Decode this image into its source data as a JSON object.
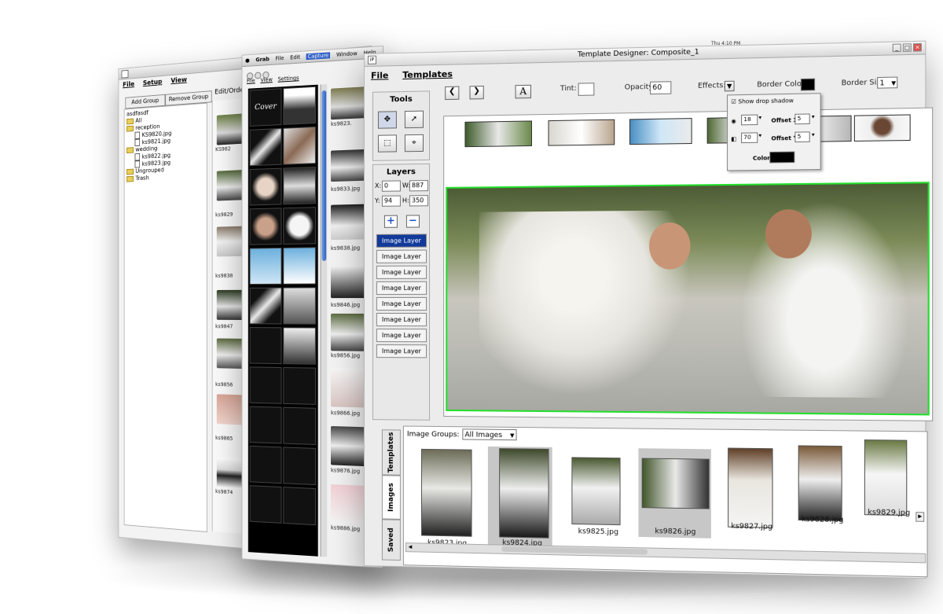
{
  "back_window": {
    "menu": [
      "File",
      "Setup",
      "View"
    ],
    "buttons": {
      "add_group": "Add Group",
      "remove_group": "Remove Group"
    },
    "tab_label": "Edit/Orde",
    "tree": [
      {
        "label": "asdfasdf",
        "type": "root"
      },
      {
        "label": "All",
        "type": "folder"
      },
      {
        "label": "reception",
        "type": "folder"
      },
      {
        "label": "KS9820.jpg",
        "type": "file"
      },
      {
        "label": "ks9821.jpg",
        "type": "file"
      },
      {
        "label": "wedding",
        "type": "folder"
      },
      {
        "label": "ks9822.jpg",
        "type": "file"
      },
      {
        "label": "ks9823.jpg",
        "type": "file"
      },
      {
        "label": "Ungrouped",
        "type": "folder"
      },
      {
        "label": "Trash",
        "type": "folder"
      }
    ],
    "thumb_labels": [
      "KS982",
      "ks9829",
      "ks9838",
      "ks9847",
      "ks9856",
      "ks9865",
      "ks9874"
    ]
  },
  "mac_window": {
    "menubar": [
      "Grab",
      "File",
      "Edit",
      "Capture",
      "Window",
      "Help"
    ],
    "clock": "Thu 4:10 PM",
    "submenu": [
      "File",
      "View",
      "Settings"
    ],
    "cover_label": "Cover",
    "thumb_labels": [
      "ks9823.",
      "ks9833.jpg",
      "ks9838.jpg",
      "ks9846.jpg",
      "ks9856.jpg",
      "ks9866.jpg",
      "ks9876.jpg",
      "ks9886.jpg"
    ]
  },
  "main_window": {
    "title": "Template Designer: Composite_1",
    "menu": [
      "File",
      "Templates"
    ],
    "toolbar": {
      "text_tool": "A",
      "tint_label": "Tint:",
      "opacity_label": "Opacity:",
      "opacity_value": "60",
      "effects_label": "Effects:",
      "border_color_label": "Border Color:",
      "border_size_label": "Border Size:",
      "border_size_value": "1"
    },
    "tools_heading": "Tools",
    "layers_heading": "Layers",
    "coords": {
      "x_label": "X:",
      "x": "0",
      "y_label": "Y:",
      "y": "94",
      "w_label": "W:",
      "w": "887",
      "h_label": "H:",
      "h": "350"
    },
    "layers": [
      "Image Layer",
      "Image Layer",
      "Image Layer",
      "Image Layer",
      "Image Layer",
      "Image Layer",
      "Image Layer",
      "Image Layer"
    ],
    "effects_popup": {
      "show_drop_shadow": "Show drop shadow",
      "val1": "18",
      "val2": "70",
      "offset_x_label": "Offset X:",
      "offset_x": "5",
      "offset_y_label": "Offset Y:",
      "offset_y": "5",
      "color_label": "Color:"
    },
    "image_groups_label": "Image Groups:",
    "image_groups_value": "All Images",
    "side_tabs": [
      "Templates",
      "Images",
      "Saved"
    ],
    "bottom_images": [
      "ks9823.jpg",
      "ks9824.jpg",
      "ks9825.jpg",
      "ks9826.jpg",
      "ks9827.jpg",
      "ks9828.jpg",
      "ks9829.jpg"
    ],
    "colors": {
      "selection": "#123a9a",
      "canvas_border": "#22e02b",
      "accent": "#2f5ec7"
    }
  }
}
